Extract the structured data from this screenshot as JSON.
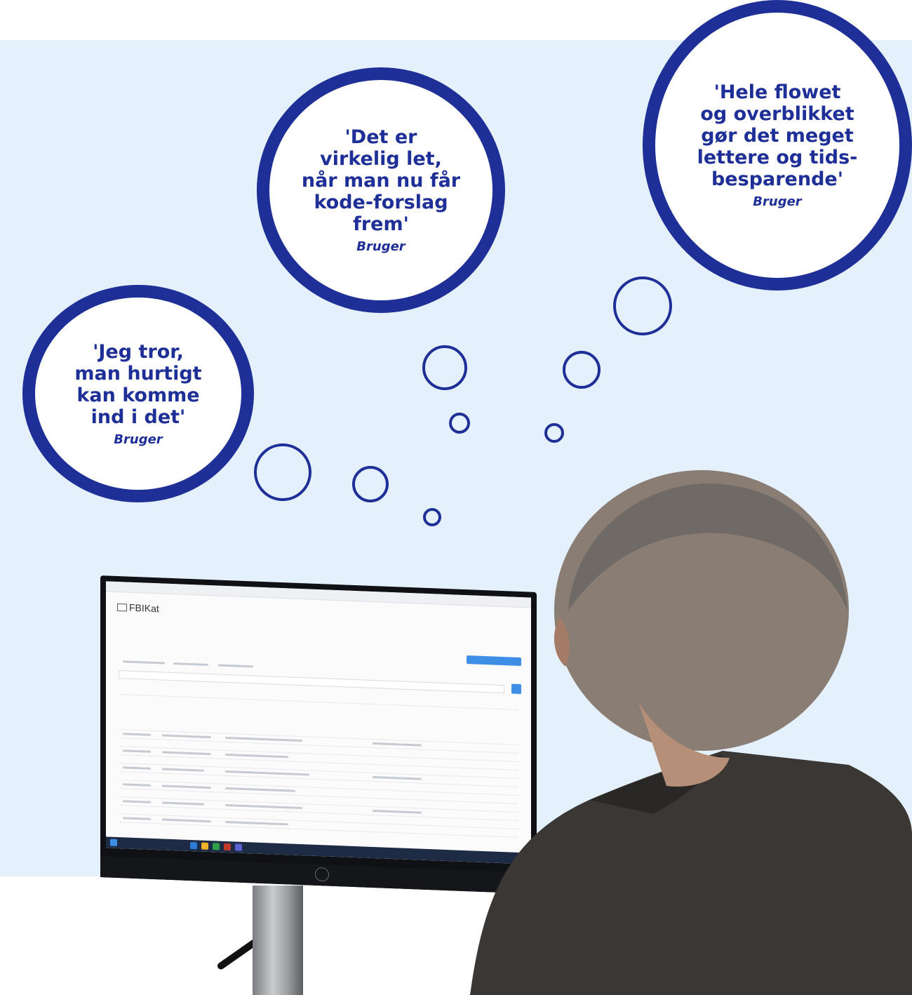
{
  "bubbles": [
    {
      "quote_lines": [
        "'Jeg tror,",
        "man hurtigt",
        "kan komme",
        "ind i det'"
      ],
      "byline": "Bruger"
    },
    {
      "quote_lines": [
        "'Det er",
        "virkelig let,",
        "når man nu får",
        "kode-forslag",
        "frem'"
      ],
      "byline": "Bruger"
    },
    {
      "quote_lines": [
        "'Hele flowet",
        "og overblikket",
        "gør det meget",
        "lettere og tids-",
        "besparende'"
      ],
      "byline": "Bruger"
    }
  ],
  "screen": {
    "app_name": "FBIKat"
  },
  "colors": {
    "navy": "#1f2f98",
    "panel": "#e4f1fc",
    "accent": "#3f8ee6"
  }
}
